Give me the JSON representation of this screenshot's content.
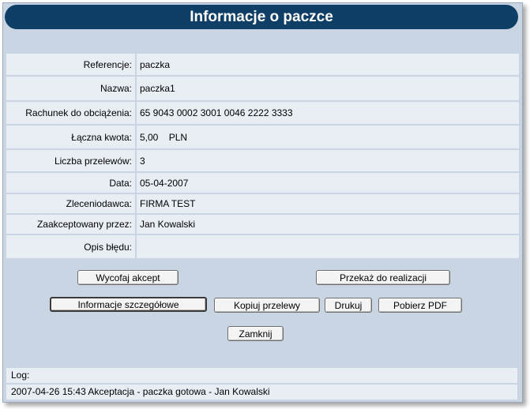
{
  "title": "Informacje o paczce",
  "fields": [
    {
      "label": "Referencje:",
      "value": "paczka"
    },
    {
      "label": "Nazwa:",
      "value": "paczka1"
    },
    {
      "label": "Rachunek do obciążenia:",
      "value": "65 9043 0002 3001 0046 2222 3333"
    },
    {
      "label": "Łączna kwota:",
      "value": "5,00    PLN"
    },
    {
      "label": "Liczba przelewów:",
      "value": "3"
    },
    {
      "label": "Data:",
      "value": "05-04-2007"
    },
    {
      "label": "Zleceniodawca:",
      "value": "FIRMA TEST"
    },
    {
      "label": "Zaakceptowany przez:",
      "value": "Jan Kowalski"
    },
    {
      "label": "Opis błędu:",
      "value": ""
    }
  ],
  "buttons": {
    "withdraw": "Wycofaj akcept",
    "submit": "Przekaż do realizacji",
    "details": "Informacje szczegółowe",
    "copy": "Kopiuj przelewy",
    "print": "Drukuj",
    "pdf": "Pobierz PDF",
    "close": "Zamknij"
  },
  "log": {
    "label": "Log:",
    "entries": [
      "2007-04-26 15:43 Akceptacja - paczka gotowa - Jan Kowalski"
    ]
  }
}
